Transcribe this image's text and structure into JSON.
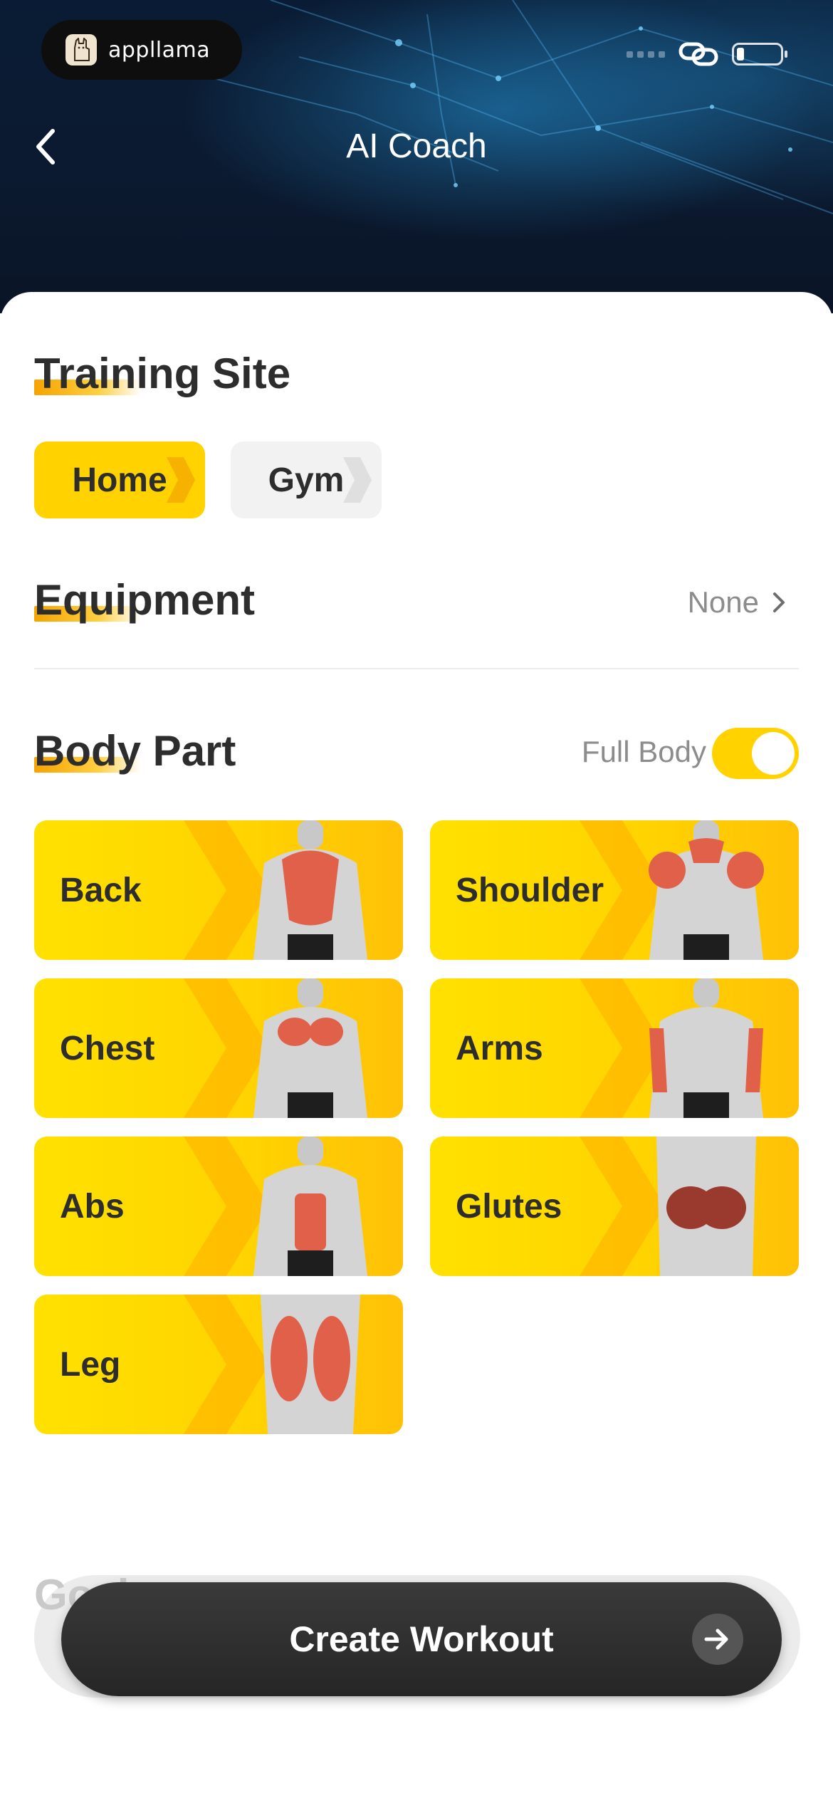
{
  "status_bar": {
    "app_badge": "appllama"
  },
  "header": {
    "title": "AI Coach"
  },
  "training_site": {
    "title": "Training Site",
    "options": [
      {
        "label": "Home",
        "selected": true
      },
      {
        "label": "Gym",
        "selected": false
      }
    ]
  },
  "equipment": {
    "title": "Equipment",
    "value": "None"
  },
  "body_part": {
    "title": "Body Part",
    "full_body_label": "Full Body",
    "full_body_on": true,
    "items": [
      {
        "label": "Back"
      },
      {
        "label": "Shoulder"
      },
      {
        "label": "Chest"
      },
      {
        "label": "Arms"
      },
      {
        "label": "Abs"
      },
      {
        "label": "Glutes"
      },
      {
        "label": "Leg"
      }
    ]
  },
  "goal": {
    "title_partial": "Goal"
  },
  "cta": {
    "label": "Create Workout"
  },
  "colors": {
    "accent": "#ffd200",
    "dark_button": "#2b2b2b",
    "muted_text": "#8c8c8c"
  }
}
